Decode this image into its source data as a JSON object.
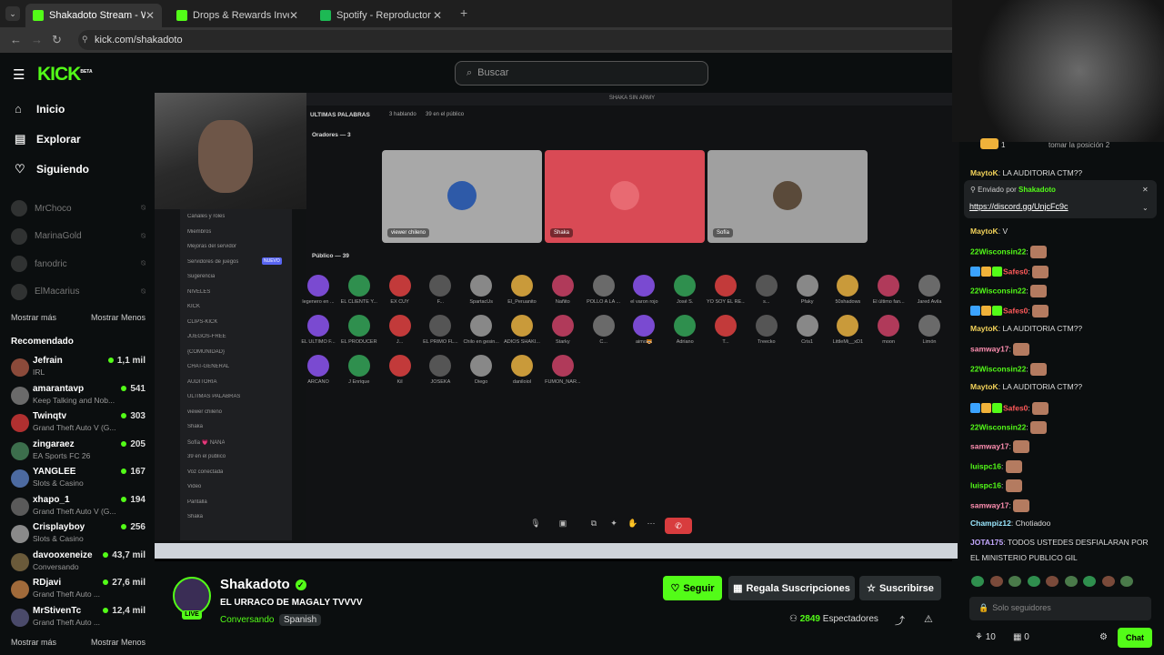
{
  "browser": {
    "tabs": [
      {
        "title": "Shakadoto Stream - Watch",
        "color": "#53fc18",
        "active": true
      },
      {
        "title": "Drops & Rewards Inventory - K",
        "color": "#53fc18",
        "active": false
      },
      {
        "title": "Spotify - Reproductor web: mú",
        "color": "#1db954",
        "active": false
      }
    ],
    "url": "kick.com/shakadoto"
  },
  "header": {
    "logo": "KICK",
    "logo_sup": "BETA",
    "search_placeholder": "Buscar"
  },
  "sidebar": {
    "nav": [
      {
        "label": "Inicio",
        "icon": "home-icon"
      },
      {
        "label": "Explorar",
        "icon": "compass-icon"
      },
      {
        "label": "Siguiendo",
        "icon": "heart-icon"
      }
    ],
    "following": [
      "MrChoco",
      "MarinaGold",
      "fanodric",
      "ElMacarius"
    ],
    "show_more": "Mostrar más",
    "show_less": "Mostrar Menos",
    "recommended_title": "Recomendado",
    "recommended": [
      {
        "name": "Jefrain",
        "category": "IRL",
        "viewers": "1,1 mil"
      },
      {
        "name": "amarantavp",
        "category": "Keep Talking and Nob...",
        "viewers": "541"
      },
      {
        "name": "Twinqtv",
        "category": "Grand Theft Auto V (G...",
        "viewers": "303"
      },
      {
        "name": "zingaraez",
        "category": "EA Sports FC 26",
        "viewers": "205"
      },
      {
        "name": "YANGLEE",
        "category": "Slots & Casino",
        "viewers": "167"
      },
      {
        "name": "xhapo_1",
        "category": "Grand Theft Auto V (G...",
        "viewers": "194"
      },
      {
        "name": "Crisplayboy",
        "category": "Slots & Casino",
        "viewers": "256"
      },
      {
        "name": "davooxeneize",
        "category": "Conversando",
        "viewers": "43,7 mil"
      },
      {
        "name": "RDjavi",
        "category": "Grand Theft Auto ...",
        "viewers": "27,6 mil"
      },
      {
        "name": "MrStivenTc",
        "category": "Grand Theft Auto ...",
        "viewers": "12,4 mil"
      }
    ]
  },
  "stream_view": {
    "window_title": "SHAKA SIN ARMY",
    "stage_label": "ULTIMAS PALABRAS",
    "speaking": "3 hablando",
    "audience_count": "39 en el público",
    "speakers_title": "Oradores — 3",
    "speakers": [
      {
        "name": "viewer chileno",
        "bg": "#a8a8a8"
      },
      {
        "name": "Shaka",
        "bg": "#d94a55"
      },
      {
        "name": "Sofía",
        "bg": "#a0a0a0"
      }
    ],
    "audience_title": "Público — 39",
    "audience": [
      "legenero en ...",
      "EL CLIENTE Y...",
      "EX CUY",
      "F...",
      "SpartacUs",
      "El_Peruanito",
      "Ñañito",
      "POLLO A LA ...",
      "el varon rojo",
      "José S.",
      "YO SOY EL RE...",
      "s...",
      "Pfaky",
      "50shadows",
      "El último fan...",
      "Jared Avila",
      "EL ULTIMO F...",
      "EL PRODUCER",
      "J...",
      "EL PRIMO FL...",
      "Chilo en gesin...",
      "ADIOS SHAKI...",
      "Starky",
      "C...",
      "aimo🐯",
      "Adriano",
      "T...",
      "Treecko",
      "Cris1",
      "LittleMi__xD1",
      "moon",
      "Limón",
      "ARCANO",
      "J Enrique",
      "Kil",
      "JOSEKA",
      "Diego",
      "daniloiol",
      "FUMON_NAR..."
    ],
    "discord_channels": [
      "Canales y roles",
      "Miembros",
      "Mejoras del servidor",
      "Servidores de juegos",
      "Sugerencia",
      "NIVELES",
      "KICK",
      "CLIPS-KICK",
      "JUEGOS-FREE",
      "{COMUNIDAD}",
      "CHAT-GENERAL",
      "AUDITORIA",
      "ULTIMAS PALABRAS",
      "viewer chileno",
      "Shaka",
      "Sofía 💗 NANA",
      "39 en el público",
      "Voz conectada",
      "Video",
      "Pantalla",
      "Shaka"
    ],
    "new_badge": "NUEVO"
  },
  "channel": {
    "name": "Shakadoto",
    "live": "LIVE",
    "title": "EL URRACO DE MAGALY TVVVV",
    "category": "Conversando",
    "language": "Spanish",
    "follow": "Seguir",
    "gift": "Regala Suscripciones",
    "subscribe": "Suscribirse",
    "viewers": "2849",
    "viewers_label": "Espectadores"
  },
  "chat": {
    "rank_count": "1",
    "rank_text": "tomar la posición 2",
    "top_msg_user": "MaytoK",
    "top_msg_text": "LA AUDITORIA CTM??",
    "pinned_by": "Enviado por",
    "pinned_user": "Shakadoto",
    "pinned_link": "https://discord.gg/UnjcFc9c",
    "messages": [
      {
        "user": "MaytoK",
        "color": "#f3d35a",
        "text": "V",
        "emote": false,
        "badges": 0
      },
      {
        "user": "22Wisconsin22",
        "color": "#53fc18",
        "text": "",
        "emote": true,
        "badges": 0
      },
      {
        "user": "Safes0",
        "color": "#ff5a5a",
        "text": "",
        "emote": true,
        "badges": 3
      },
      {
        "user": "22Wisconsin22",
        "color": "#53fc18",
        "text": "",
        "emote": true,
        "badges": 0
      },
      {
        "user": "Safes0",
        "color": "#ff5a5a",
        "text": "",
        "emote": true,
        "badges": 3
      },
      {
        "user": "MaytoK",
        "color": "#f3d35a",
        "text": "LA AUDITORIA CTM??",
        "emote": false,
        "badges": 0
      },
      {
        "user": "samway17",
        "color": "#ff8fb1",
        "text": "",
        "emote": true,
        "badges": 0
      },
      {
        "user": "22Wisconsin22",
        "color": "#53fc18",
        "text": "",
        "emote": true,
        "badges": 0
      },
      {
        "user": "MaytoK",
        "color": "#f3d35a",
        "text": "LA AUDITORIA CTM??",
        "emote": false,
        "badges": 0
      },
      {
        "user": "Safes0",
        "color": "#ff5a5a",
        "text": "",
        "emote": true,
        "badges": 3
      },
      {
        "user": "22Wisconsin22",
        "color": "#53fc18",
        "text": "",
        "emote": true,
        "badges": 0
      },
      {
        "user": "samway17",
        "color": "#ff8fb1",
        "text": "",
        "emote": true,
        "badges": 0
      },
      {
        "user": "luispc16",
        "color": "#53fc18",
        "text": "",
        "emote": true,
        "badges": 0
      },
      {
        "user": "luispc16",
        "color": "#53fc18",
        "text": "",
        "emote": true,
        "badges": 0
      },
      {
        "user": "samway17",
        "color": "#ff8fb1",
        "text": "",
        "emote": true,
        "badges": 0
      },
      {
        "user": "Champiz12",
        "color": "#9be8ff",
        "text": "Chotiadoo",
        "emote": false,
        "badges": 0
      },
      {
        "user": "JOTA175",
        "color": "#c4a8ff",
        "text": "TODOS USTEDES DESFIALARAN POR",
        "emote": false,
        "badges": 0
      }
    ],
    "wrap_line": "EL MINISTERIO PUBLICO GIL",
    "input_placeholder": "Solo seguidores",
    "points": "10",
    "gifts": "0",
    "send_button": "Chat"
  }
}
